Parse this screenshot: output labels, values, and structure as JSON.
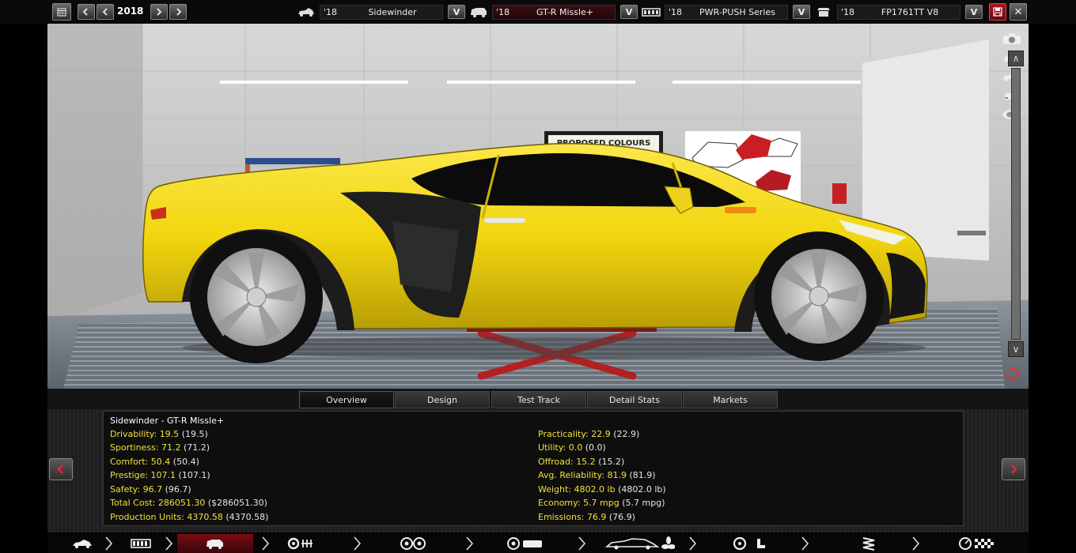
{
  "topbar": {
    "year": "2018",
    "calendar_icon": "calendar-icon",
    "selectors": [
      {
        "icon": "car-model-icon",
        "year": "'18",
        "name": "Sidewinder",
        "highlight": false
      },
      {
        "icon": "car-trim-icon",
        "year": "'18",
        "name": "GT-R Missle+",
        "highlight": true
      },
      {
        "icon": "engine-family-icon",
        "year": "'18",
        "name": "PWR-PUSH Series",
        "highlight": false
      },
      {
        "icon": "engine-variant-icon",
        "year": "'18",
        "name": "FP1761TT V8",
        "highlight": false
      }
    ],
    "dropdown_glyph": "V",
    "save_icon": "save-icon",
    "close_glyph": "✕",
    "accent_color": "#b3121f"
  },
  "viewport": {
    "poster_text": "PROPOSED COLOURS",
    "car_color": "#f4dc18",
    "scroll_up": "∧",
    "scroll_down": "∨",
    "camera_icons": [
      "camera-icon",
      "front-view-icon",
      "side-view-icon",
      "rear-view-icon",
      "top-view-icon"
    ]
  },
  "tabs": [
    "Overview",
    "Design",
    "Test Track",
    "Detail Stats",
    "Markets"
  ],
  "active_tab": "Overview",
  "stats": {
    "title": "Sidewinder - GT-R Missle+",
    "left": [
      {
        "label": "Drivability:",
        "value": "19.5",
        "paren": "(19.5)"
      },
      {
        "label": "Sportiness:",
        "value": "71.2",
        "paren": "(71.2)"
      },
      {
        "label": "Comfort:",
        "value": "50.4",
        "paren": "(50.4)"
      },
      {
        "label": "Prestige:",
        "value": "107.1",
        "paren": "(107.1)"
      },
      {
        "label": "Safety:",
        "value": "96.7",
        "paren": "(96.7)"
      },
      {
        "label": "Total Cost:",
        "value": "286051.30",
        "paren": "($286051.30)"
      },
      {
        "label": "Production Units:",
        "value": "4370.58",
        "paren": "(4370.58)"
      }
    ],
    "right": [
      {
        "label": "Practicality:",
        "value": "22.9",
        "paren": "(22.9)"
      },
      {
        "label": "Utility:",
        "value": "0.0",
        "paren": "(0.0)"
      },
      {
        "label": "Offroad:",
        "value": "15.2",
        "paren": "(15.2)"
      },
      {
        "label": "Avg. Reliability:",
        "value": "81.9",
        "paren": "(81.9)"
      },
      {
        "label": "Weight:",
        "value": "4802.0 lb",
        "paren": "(4802.0 lb)"
      },
      {
        "label": "Economy:",
        "value": "5.7 mpg",
        "paren": "(5.7 mpg)"
      },
      {
        "label": "Emissions:",
        "value": "76.9",
        "paren": "(76.9)"
      }
    ]
  },
  "bottomnav": {
    "items": [
      "model-icon",
      "chassis-icon",
      "body-icon",
      "engine-icon",
      "wheels-icon",
      "brakes-icon",
      "aero-icon",
      "interior-icon",
      "suspension-icon",
      "testing-icon"
    ],
    "active_index": 2
  }
}
